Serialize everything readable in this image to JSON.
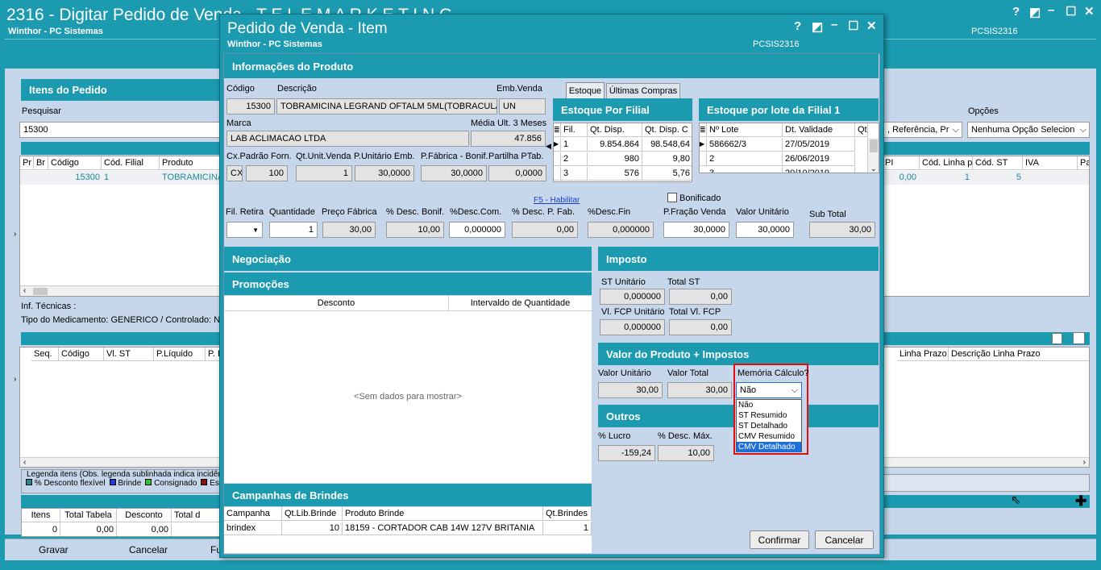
{
  "main_window": {
    "title": "2316 - Digitar Pedido de Venda - T E L E M A R K E T I N G",
    "subtitle": "Winthor - PC Sistemas",
    "code": "PCSIS2316",
    "items_header": "Itens do Pedido",
    "search_label": "Pesquisar",
    "search_value": "15300",
    "options_label": "Opções",
    "search_by_value": ", Referência, Pr",
    "options_value": "Nenhuma Opção Selecion",
    "items_columns": [
      "Pr",
      "Br",
      "Código",
      "Cód. Filial",
      "Produto"
    ],
    "items_row": {
      "codigo": "15300",
      "cod_filial": "1",
      "produto": "TOBRAMICINA"
    },
    "right_columns": [
      "PI",
      "Cód. Linha pı",
      "Cód. ST",
      "IVA",
      "Pa"
    ],
    "right_row": {
      "pi": "0,00",
      "linha": "1",
      "st": "5"
    },
    "inf_tecnicas": "Inf. Técnicas :",
    "tipo_medicamento": "Tipo do Medicamento: GENERICO / Controlado: Não",
    "lower_columns": [
      "Seq.",
      "Código",
      "Vl. ST",
      "P.Líquido",
      "P. E"
    ],
    "lower_right_columns": [
      "Linha Prazo",
      "Descrição Linha Prazo"
    ],
    "legend_title": "Legenda itens (Obs. legenda sublinhada indica incidência d",
    "legend_items": [
      "% Desconto flexível",
      "Brinde",
      "Consignado",
      "Estoque"
    ],
    "totals_columns": [
      "Itens",
      "Total Tabela",
      "Desconto",
      "Total d"
    ],
    "totals_values": [
      "0",
      "0,00",
      "0,00",
      ""
    ],
    "bottom_buttons": [
      "Gravar",
      "Cancelar",
      "Fu"
    ]
  },
  "dialog": {
    "title": "Pedido de Venda - Item",
    "subtitle": "Winthor - PC Sistemas",
    "code": "PCSIS2316",
    "info_header": "Informações do Produto",
    "codigo_label": "Código",
    "codigo_value": "15300",
    "descricao_label": "Descrição",
    "descricao_value": "TOBRAMICINA LEGRAND OFTALM 5ML(TOBRACULA",
    "emb_label": "Emb.Venda",
    "emb_value": "UN",
    "marca_label": "Marca",
    "marca_value": "LAB ACLIMACAO LTDA",
    "media_label": "Média Ult. 3 Meses",
    "media_value": "47.856",
    "cx_label": "Cx.Padrão Forn.",
    "cx_unit": "CX",
    "cx_value": "100",
    "qt_unit_label": "Qt.Unit.Venda",
    "qt_unit_value": "1",
    "p_unit_label": "P.Unitário Emb.",
    "p_unit_value": "30,0000",
    "p_fab_label": "P.Fábrica - Bonif.",
    "p_fab_value": "30,0000",
    "partilha_label": "Partilha PTab.",
    "partilha_value": "0,0000",
    "tabs": [
      "Estoque",
      "Últimas Compras"
    ],
    "estoque_filial_header": "Estoque Por Filial",
    "estoque_filial_columns": [
      "Fil.",
      "Qt. Disp.",
      "Qt. Disp. C"
    ],
    "estoque_filial_rows": [
      [
        "1",
        "9.854.864",
        "98.548,64"
      ],
      [
        "2",
        "980",
        "9,80"
      ],
      [
        "3",
        "576",
        "5,76"
      ]
    ],
    "estoque_lote_header": "Estoque por lote da Filial 1",
    "estoque_lote_columns": [
      "Nº Lote",
      "Dt. Validade",
      "Qt"
    ],
    "estoque_lote_rows": [
      [
        "586662/3",
        "27/05/2019"
      ],
      [
        "2",
        "26/06/2019"
      ],
      [
        "3",
        "20/10/2019"
      ]
    ],
    "f5_link": "F5 - Habilitar",
    "bonificado_label": "Bonificado",
    "fil_retira_label": "Fil. Retira",
    "quantidade_label": "Quantidade",
    "quantidade_value": "1",
    "preco_fabrica_label": "Preço Fábrica",
    "preco_fabrica_value": "30,00",
    "desc_bonif_label": "% Desc. Bonif.",
    "desc_bonif_value": "10,00",
    "desc_com_label": "%Desc.Com.",
    "desc_com_value": "0,000000",
    "desc_pfab_label": "% Desc. P. Fab.",
    "desc_pfab_value": "0,00",
    "desc_fin_label": "%Desc.Fin",
    "desc_fin_value": "0,000000",
    "pfracao_label": "P.Fração Venda",
    "pfracao_value": "30,0000",
    "valor_unit_label": "Valor Unitário",
    "valor_unit_value": "30,0000",
    "subtotal_label": "Sub Total",
    "subtotal_value": "30,00",
    "negociacao_header": "Negociação",
    "promocoes_header": "Promoções",
    "promo_columns": [
      "Desconto",
      "Intervaldo de Quantidade"
    ],
    "promo_empty": "<Sem dados para mostrar>",
    "imposto_header": "Imposto",
    "st_unit_label": "ST Unitário",
    "st_unit_value": "0,000000",
    "total_st_label": "Total ST",
    "total_st_value": "0,00",
    "fcp_unit_label": "Vl. FCP Unitário",
    "fcp_unit_value": "0,000000",
    "fcp_total_label": "Total Vl. FCP",
    "fcp_total_value": "0,00",
    "valor_prod_header": "Valor do Produto + Impostos",
    "vp_unit_label": "Valor Unitário",
    "vp_unit_value": "30,00",
    "vp_total_label": "Valor Total",
    "vp_total_value": "30,00",
    "memoria_label": "Memória Cálculo?",
    "memoria_selected": "Não",
    "memoria_options": [
      "Não",
      "ST Resumido",
      "ST Detalhado",
      "CMV Resumido",
      "CMV Detalhado"
    ],
    "outros_header": "Outros",
    "lucro_label": "% Lucro",
    "lucro_value": "-159,24",
    "desc_max_label": "% Desc. Máx.",
    "desc_max_value": "10,00",
    "campanhas_header": "Campanhas de Brindes",
    "campanhas_columns": [
      "Campanha",
      "Qt.Lib.Brinde",
      "Produto Brinde",
      "Qt.Brindes"
    ],
    "campanhas_row": [
      "brindex",
      "10",
      "18159 - CORTADOR CAB 14W 127V BRITANIA",
      "1"
    ],
    "confirm_button": "Confirmar",
    "cancel_button": "Cancelar"
  },
  "colors": {
    "teal": "#1b9ab0",
    "panel": "#c6d7ec",
    "highlight_red": "#e01010",
    "selected_blue": "#1e6fd9"
  }
}
